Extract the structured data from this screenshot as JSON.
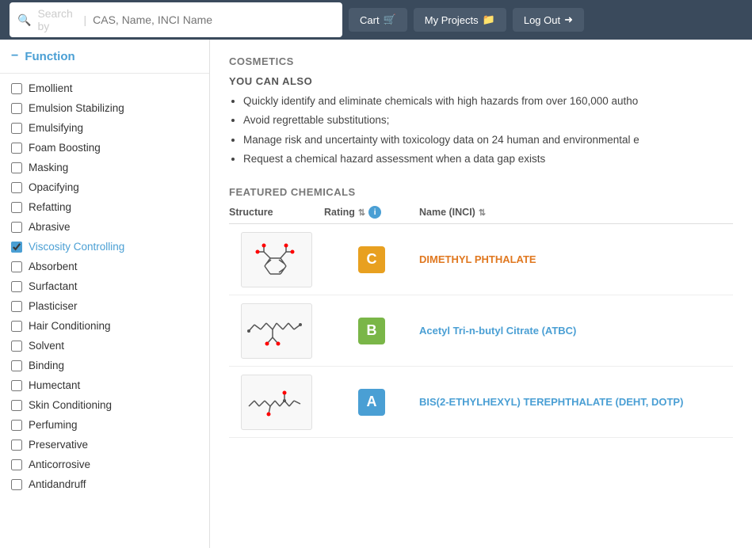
{
  "header": {
    "search_placeholder": "CAS, Name, INCI Name",
    "search_by_label": "Search by",
    "cart_label": "Cart",
    "my_projects_label": "My Projects",
    "logout_label": "Log Out"
  },
  "sidebar": {
    "section_title": "Function",
    "items": [
      {
        "id": "emollient",
        "label": "Emollient",
        "checked": false
      },
      {
        "id": "emulsion-stabilizing",
        "label": "Emulsion Stabilizing",
        "checked": false
      },
      {
        "id": "emulsifying",
        "label": "Emulsifying",
        "checked": false
      },
      {
        "id": "foam-boosting",
        "label": "Foam Boosting",
        "checked": false
      },
      {
        "id": "masking",
        "label": "Masking",
        "checked": false
      },
      {
        "id": "opacifying",
        "label": "Opacifying",
        "checked": false
      },
      {
        "id": "refatting",
        "label": "Refatting",
        "checked": false
      },
      {
        "id": "abrasive",
        "label": "Abrasive",
        "checked": false
      },
      {
        "id": "viscosity-controlling",
        "label": "Viscosity Controlling",
        "checked": true
      },
      {
        "id": "absorbent",
        "label": "Absorbent",
        "checked": false
      },
      {
        "id": "surfactant",
        "label": "Surfactant",
        "checked": false
      },
      {
        "id": "plasticiser",
        "label": "Plasticiser",
        "checked": false
      },
      {
        "id": "hair-conditioning",
        "label": "Hair Conditioning",
        "checked": false
      },
      {
        "id": "solvent",
        "label": "Solvent",
        "checked": false
      },
      {
        "id": "binding",
        "label": "Binding",
        "checked": false
      },
      {
        "id": "humectant",
        "label": "Humectant",
        "checked": false
      },
      {
        "id": "skin-conditioning",
        "label": "Skin Conditioning",
        "checked": false
      },
      {
        "id": "perfuming",
        "label": "Perfuming",
        "checked": false
      },
      {
        "id": "preservative",
        "label": "Preservative",
        "checked": false
      },
      {
        "id": "anticorrosive",
        "label": "Anticorrosive",
        "checked": false
      },
      {
        "id": "antidandruff",
        "label": "Antidandruff",
        "checked": false
      }
    ]
  },
  "main": {
    "cosmetics_title": "COSMETICS",
    "you_can_also_title": "YOU CAN ALSO",
    "bullets": [
      "Quickly identify and eliminate chemicals with high hazards from over 160,000 autho",
      "Avoid regrettable substitutions;",
      "Manage risk and uncertainty with toxicology data on 24 human and environmental e",
      "Request a chemical hazard assessment when a data gap exists"
    ],
    "featured_title": "FEATURED CHEMICALS",
    "table_headers": {
      "structure": "Structure",
      "rating": "Rating",
      "name": "Name (INCI)"
    },
    "chemicals": [
      {
        "id": "dimethyl-phthalate",
        "rating": "C",
        "rating_class": "rating-c",
        "name": "DIMETHYL PHTHALATE",
        "name_class": "orange"
      },
      {
        "id": "acetyl-tri-n-butyl-citrate",
        "rating": "B",
        "rating_class": "rating-b",
        "name": "Acetyl Tri-n-butyl Citrate (ATBC)",
        "name_class": "teal"
      },
      {
        "id": "bis-2-ethylhexyl-terephthalate",
        "rating": "A",
        "rating_class": "rating-a",
        "name": "BIS(2-ETHYLHEXYL) TEREPHTHALATE (DEHT, DOTP)",
        "name_class": "teal"
      }
    ]
  }
}
